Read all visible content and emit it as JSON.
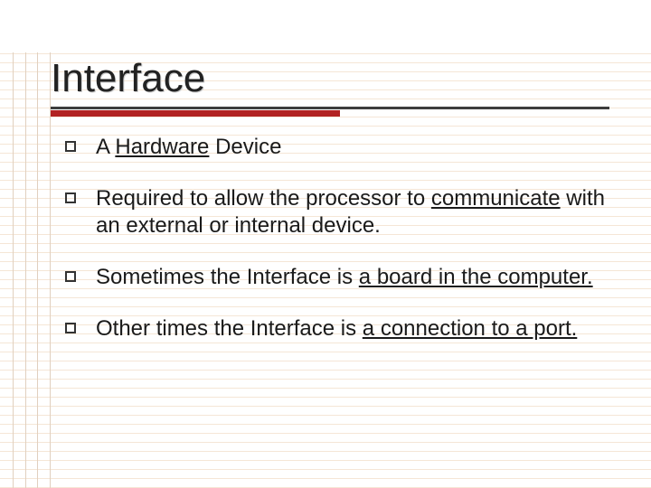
{
  "slide": {
    "title": "Interface",
    "bullets": [
      {
        "segments": [
          {
            "text": "A ",
            "underline": false
          },
          {
            "text": "Hardware",
            "underline": true
          },
          {
            "text": " Device",
            "underline": false
          }
        ]
      },
      {
        "segments": [
          {
            "text": "Required to allow the processor to ",
            "underline": false
          },
          {
            "text": "communicate",
            "underline": true
          },
          {
            "text": " with an external or internal device.",
            "underline": false
          }
        ]
      },
      {
        "segments": [
          {
            "text": "Sometimes the Interface is ",
            "underline": false
          },
          {
            "text": "a board in the computer.",
            "underline": true
          }
        ]
      },
      {
        "segments": [
          {
            "text": "Other times the Interface is ",
            "underline": false
          },
          {
            "text": "a connection to a port.",
            "underline": true
          }
        ]
      }
    ]
  }
}
